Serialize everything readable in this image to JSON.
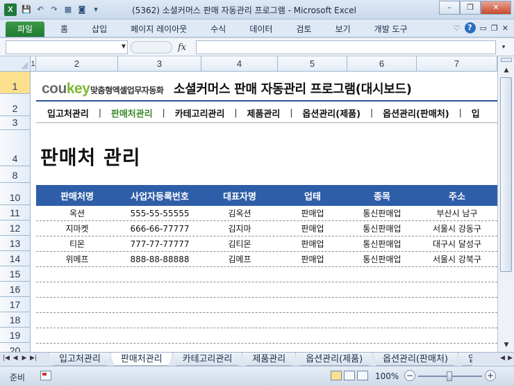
{
  "window": {
    "title": "(5362) 소셜커머스 판매 자동관리 프로그램 - Microsoft Excel",
    "app_icon_letter": "X",
    "min_label": "▭",
    "restore_label": "❐",
    "close_label": "✕"
  },
  "qat": {
    "save_icon": "💾",
    "undo_icon": "↶",
    "redo_icon": "↷",
    "customize_icon": "▾"
  },
  "ribbon": {
    "file_tab": "파일",
    "tabs": [
      "홈",
      "삽입",
      "페이지 레이아웃",
      "수식",
      "데이터",
      "검토",
      "보기",
      "개발 도구"
    ],
    "help_icon": "?"
  },
  "formula_bar": {
    "name_box_value": "",
    "fx_label": "fx",
    "formula_value": ""
  },
  "columns": [
    "1",
    "2",
    "3",
    "4",
    "5",
    "6",
    "7"
  ],
  "rows": [
    "1",
    "2",
    "3",
    "4",
    "8",
    "10",
    "11",
    "12",
    "13",
    "14",
    "15",
    "16",
    "17",
    "18",
    "19",
    "20"
  ],
  "brand": {
    "cou": "cou",
    "key": "key",
    "subtitle": "맞춤형엑셀업무자동화"
  },
  "app_title": "소셜커머스 판매 자동관리 프로그램(대시보드)",
  "nav": {
    "items": [
      "입고처관리",
      "판매처관리",
      "카테고리관리",
      "제품관리",
      "옵션관리(제품)",
      "옵션관리(판매처)",
      "입"
    ],
    "separator": "|",
    "active_index": 1
  },
  "page_heading": "판매처 관리",
  "table": {
    "headers": [
      "판매처명",
      "사업자등록번호",
      "대표자명",
      "업태",
      "종목",
      "주소"
    ],
    "rows": [
      [
        "옥션",
        "555-55-55555",
        "김옥션",
        "판매업",
        "통신판매업",
        "부산시 남구"
      ],
      [
        "지마켓",
        "666-66-77777",
        "김지마",
        "판매업",
        "통신판매업",
        "서울시 강동구"
      ],
      [
        "티몬",
        "777-77-77777",
        "김티몬",
        "판매업",
        "통신판매업",
        "대구시 달성구"
      ],
      [
        "위메프",
        "888-88-88888",
        "김메프",
        "판매업",
        "통신판매업",
        "서울시 강북구"
      ],
      [
        "",
        "",
        "",
        "",
        "",
        ""
      ],
      [
        "",
        "",
        "",
        "",
        "",
        ""
      ],
      [
        "",
        "",
        "",
        "",
        "",
        ""
      ],
      [
        "",
        "",
        "",
        "",
        "",
        ""
      ],
      [
        "",
        "",
        "",
        "",
        "",
        ""
      ]
    ]
  },
  "sheet_tabs": {
    "items": [
      "입고처관리",
      "판매처관리",
      "카테고리관리",
      "제품관리",
      "옵션관리(제품)",
      "옵션관리(판매처)",
      "입"
    ],
    "active_index": 1
  },
  "status": {
    "ready": "준비",
    "zoom": "100%"
  }
}
